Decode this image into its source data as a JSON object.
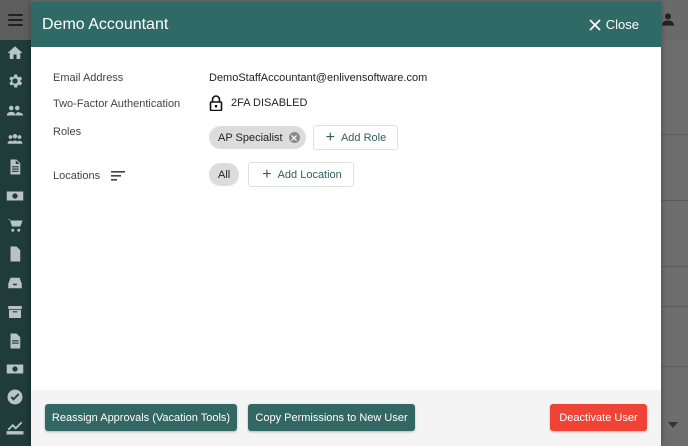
{
  "modal": {
    "title": "Demo Accountant",
    "close_label": "Close"
  },
  "details": {
    "email_label": "Email Address",
    "email_value": "DemoStaffAccountant@enlivensoftware.com",
    "twofa_label": "Two-Factor Authentication",
    "twofa_value": "2FA DISABLED",
    "roles_label": "Roles",
    "roles": [
      "AP Specialist"
    ],
    "add_role_label": "Add Role",
    "locations_label": "Locations",
    "locations": [
      "All"
    ],
    "add_location_label": "Add Location"
  },
  "footer": {
    "reassign_label": "Reassign Approvals (Vacation Tools)",
    "copy_label": "Copy Permissions to New User",
    "deactivate_label": "Deactivate User"
  },
  "colors": {
    "header": "#2f6a67",
    "primary_button": "#336764",
    "danger_button": "#ef4336"
  },
  "sidebar_icons": [
    "home-icon",
    "gear-icon",
    "users-gear-icon",
    "users-icon",
    "document-icon",
    "money-icon",
    "cart-icon",
    "file-icon",
    "inbox-icon",
    "archive-icon",
    "invoice-icon",
    "cash-icon",
    "check-circle-icon",
    "chart-icon"
  ]
}
